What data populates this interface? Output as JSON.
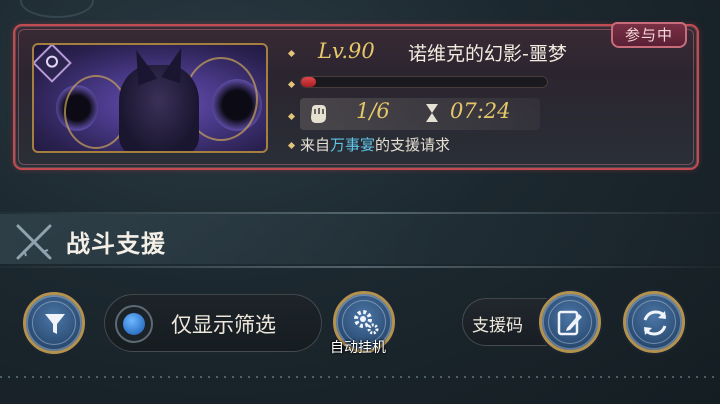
{
  "raid_card": {
    "status_tab": "参与中",
    "level": "Lv.90",
    "boss_name": "诺维克的幻影-噩梦",
    "hp_fraction": 0.06,
    "participants": "1/6",
    "timer": "07:24",
    "request_prefix": "来自",
    "request_player": "万事宴",
    "request_suffix": "的支援请求",
    "border_color": "#c24b52"
  },
  "section": {
    "title": "战斗支援",
    "icon": "crossed-swords-icon"
  },
  "controls": {
    "filter_icon": "filter-funnel-icon",
    "filter_toggle_label": "仅显示筛选",
    "auto_label": "自动挂机",
    "auto_icon": "gear-icon",
    "support_code_label": "支援码",
    "support_code_icon": "edit-note-icon",
    "refresh_icon": "refresh-icon"
  }
}
